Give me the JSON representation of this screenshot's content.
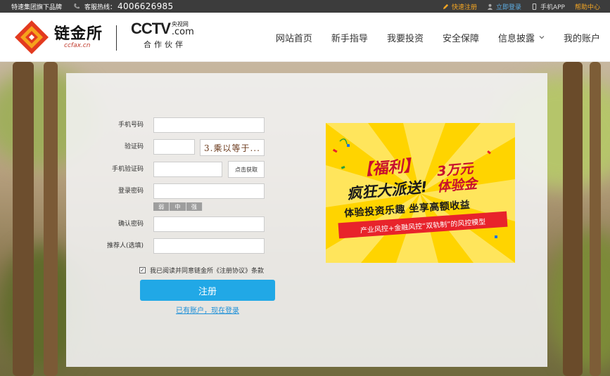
{
  "topbar": {
    "brand": "特速集团旗下品牌",
    "hotline_label": "客服热线：",
    "hotline_number": "4006626985",
    "links": {
      "register": "快速注册",
      "login": "立即登录",
      "app": "手机APP",
      "help": "帮助中心"
    }
  },
  "header": {
    "logo_cn": "链金所",
    "logo_en": "ccfax.cn",
    "cctv_word": "CCTV",
    "cctv_cn": "央视网",
    "cctv_com": ".com",
    "cctv_partner": "合作伙伴",
    "nav": [
      "网站首页",
      "新手指导",
      "我要投资",
      "安全保障",
      "信息披露",
      "我的账户"
    ]
  },
  "form": {
    "phone_label": "手机号码",
    "captcha_label": "验证码",
    "captcha_text": "3.乘以等于...",
    "sms_label": "手机验证码",
    "sms_button": "点击获取",
    "password_label": "登录密码",
    "strength": [
      "弱",
      "中",
      "强"
    ],
    "confirm_label": "确认密码",
    "referrer_label": "推荐人(选填)",
    "agree_text": "我已阅读并同意链金所《注册协议》条款",
    "register_button": "注册",
    "login_link": "已有账户，现在登录"
  },
  "banner": {
    "title_fuli": "【福利】",
    "amount": "3万元",
    "title_party": "疯狂大派送!",
    "experience": "体验金",
    "subtitle": "体验投资乐趣  坐享高额收益",
    "strip": "产业风控+金融风控“双轨制”的风控模型",
    "accent_color": "#ffd400",
    "strip_color": "#e8232b"
  },
  "colors": {
    "primary": "#21a8e6",
    "topbar": "#3c3c3c",
    "orange_link": "#f5a623"
  }
}
